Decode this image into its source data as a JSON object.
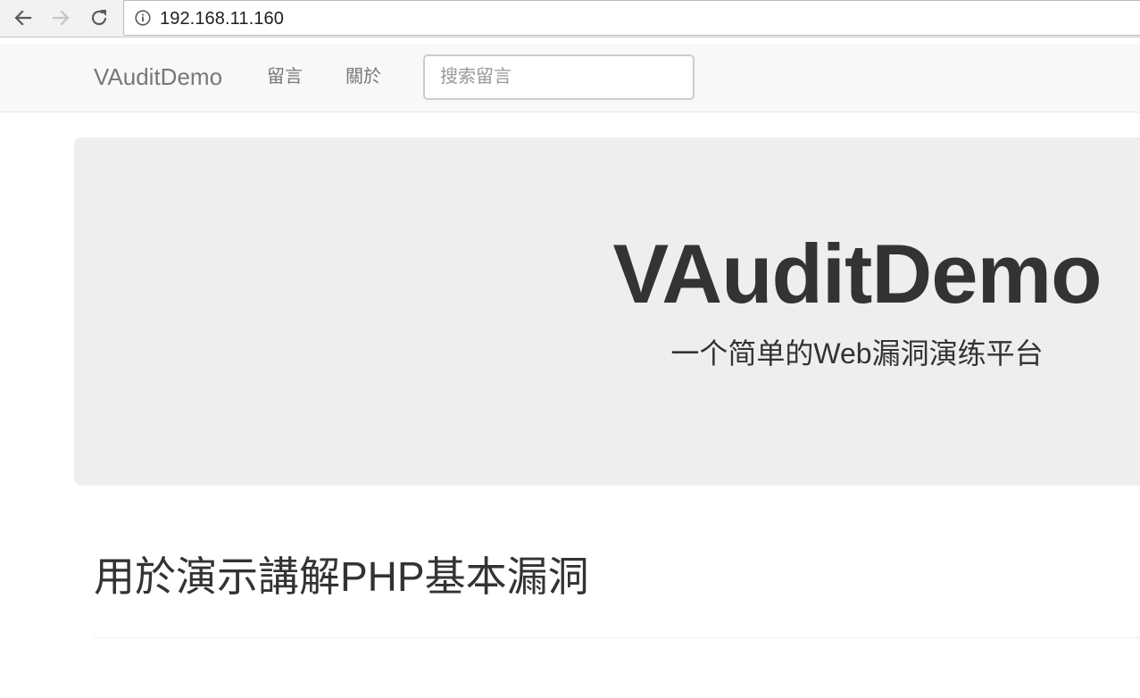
{
  "browser": {
    "url": "192.168.11.160",
    "icons": {
      "back": "arrow-left-icon",
      "forward": "arrow-right-icon",
      "reload": "reload-icon",
      "site_info": "info-icon"
    }
  },
  "navbar": {
    "brand": "VAuditDemo",
    "links": [
      "留言",
      "關於"
    ],
    "search": {
      "value": "",
      "placeholder": "搜索留言"
    }
  },
  "jumbotron": {
    "title": "VAuditDemo",
    "subtitle": "一个简单的Web漏洞演练平台"
  },
  "page_header": {
    "title": "用於演示講解PHP基本漏洞"
  },
  "colors": {
    "navbar_bg": "#f8f8f8",
    "navbar_text": "#777777",
    "jumbotron_bg": "#eeeeee",
    "heading_text": "#333333"
  }
}
